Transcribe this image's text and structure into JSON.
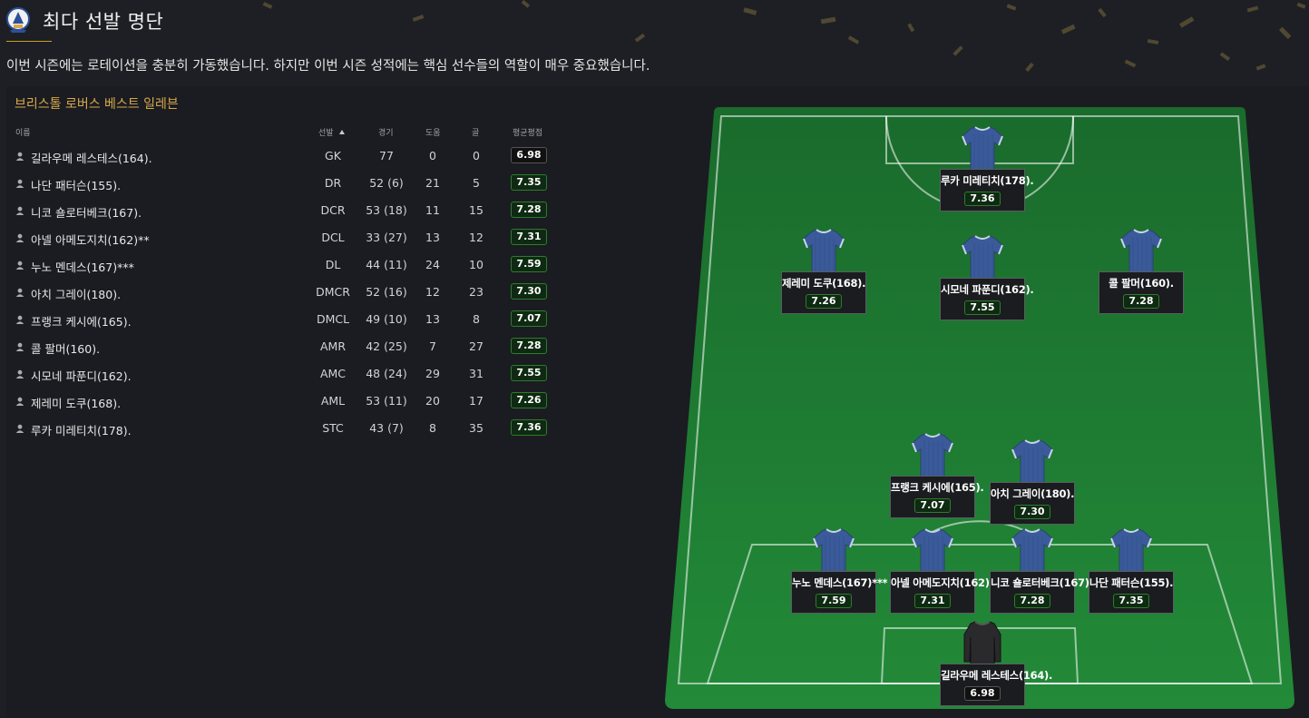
{
  "header": {
    "title": "최다 선발 명단",
    "subtitle": "이번 시즌에는 로테이션을 충분히 가동했습니다. 하지만 이번 시즌 성적에는 핵심 선수들의 역할이 매우 중요했습니다."
  },
  "panel": {
    "title": "브리스톨 로버스 베스트 일레븐"
  },
  "table": {
    "headers": {
      "name": "이름",
      "position": "선발",
      "apps": "경기",
      "assists": "도움",
      "goals": "골",
      "rating": "평균평점"
    },
    "sort": "선발 ascending",
    "rows": [
      {
        "name": "길라우메 레스테스(164).",
        "position": "GK",
        "apps": "77",
        "assists": "0",
        "goals": "0",
        "rating": "6.98",
        "rating_style": "neutral"
      },
      {
        "name": "나단 패터슨(155).",
        "position": "DR",
        "apps": "52 (6)",
        "assists": "21",
        "goals": "5",
        "rating": "7.35",
        "rating_style": "good"
      },
      {
        "name": "니코 숄로터베크(167).",
        "position": "DCR",
        "apps": "53 (18)",
        "assists": "11",
        "goals": "15",
        "rating": "7.28",
        "rating_style": "good"
      },
      {
        "name": "아넬 아메도지치(162)**",
        "position": "DCL",
        "apps": "33 (27)",
        "assists": "13",
        "goals": "12",
        "rating": "7.31",
        "rating_style": "good"
      },
      {
        "name": "누노 멘데스(167)***",
        "position": "DL",
        "apps": "44 (11)",
        "assists": "24",
        "goals": "10",
        "rating": "7.59",
        "rating_style": "good"
      },
      {
        "name": "아치 그레이(180).",
        "position": "DMCR",
        "apps": "52 (16)",
        "assists": "12",
        "goals": "23",
        "rating": "7.30",
        "rating_style": "good"
      },
      {
        "name": "프랭크 케시에(165).",
        "position": "DMCL",
        "apps": "49 (10)",
        "assists": "13",
        "goals": "8",
        "rating": "7.07",
        "rating_style": "good"
      },
      {
        "name": "콜 팔머(160).",
        "position": "AMR",
        "apps": "42 (25)",
        "assists": "7",
        "goals": "27",
        "rating": "7.28",
        "rating_style": "good"
      },
      {
        "name": "시모네 파푼디(162).",
        "position": "AMC",
        "apps": "48 (24)",
        "assists": "29",
        "goals": "31",
        "rating": "7.55",
        "rating_style": "good"
      },
      {
        "name": "제레미 도쿠(168).",
        "position": "AML",
        "apps": "53 (11)",
        "assists": "20",
        "goals": "17",
        "rating": "7.26",
        "rating_style": "good"
      },
      {
        "name": "루카 미레티치(178).",
        "position": "STC",
        "apps": "43 (7)",
        "assists": "8",
        "goals": "35",
        "rating": "7.36",
        "rating_style": "good"
      }
    ]
  },
  "pitch": {
    "players": [
      {
        "id": "stc",
        "name": "루카 미레티치(178).",
        "rating": "7.36",
        "kit": "outfield",
        "rating_style": "good"
      },
      {
        "id": "aml",
        "name": "제레미 도쿠(168).",
        "rating": "7.26",
        "kit": "outfield",
        "rating_style": "good"
      },
      {
        "id": "amc",
        "name": "시모네 파푼디(162).",
        "rating": "7.55",
        "kit": "outfield",
        "rating_style": "good"
      },
      {
        "id": "amr",
        "name": "콜 팔머(160).",
        "rating": "7.28",
        "kit": "outfield",
        "rating_style": "good"
      },
      {
        "id": "dmcl",
        "name": "프랭크 케시에(165).",
        "rating": "7.07",
        "kit": "outfield",
        "rating_style": "good"
      },
      {
        "id": "dmcr",
        "name": "아치 그레이(180).",
        "rating": "7.30",
        "kit": "outfield",
        "rating_style": "good"
      },
      {
        "id": "dl",
        "name": "누노 멘데스(167)***",
        "rating": "7.59",
        "kit": "outfield",
        "rating_style": "good"
      },
      {
        "id": "dcl",
        "name": "아넬 아메도지치(162)**",
        "rating": "7.31",
        "kit": "outfield",
        "rating_style": "good"
      },
      {
        "id": "dcr",
        "name": "니코 숄로터베크(167).",
        "rating": "7.28",
        "kit": "outfield",
        "rating_style": "good"
      },
      {
        "id": "dr",
        "name": "나단 패터슨(155).",
        "rating": "7.35",
        "kit": "outfield",
        "rating_style": "good"
      },
      {
        "id": "gk",
        "name": "길라우메 레스테스(164).",
        "rating": "6.98",
        "kit": "goalkeeper",
        "rating_style": "neutral"
      }
    ]
  },
  "colors": {
    "accent": "#c9a227",
    "panel_title": "#d9a84a",
    "pitch_green": "#1e7a33",
    "outfield_kit": "#3a5a9a",
    "goalkeeper_kit": "#2a2a2c",
    "rating_good_border": "#2f7a2f"
  }
}
